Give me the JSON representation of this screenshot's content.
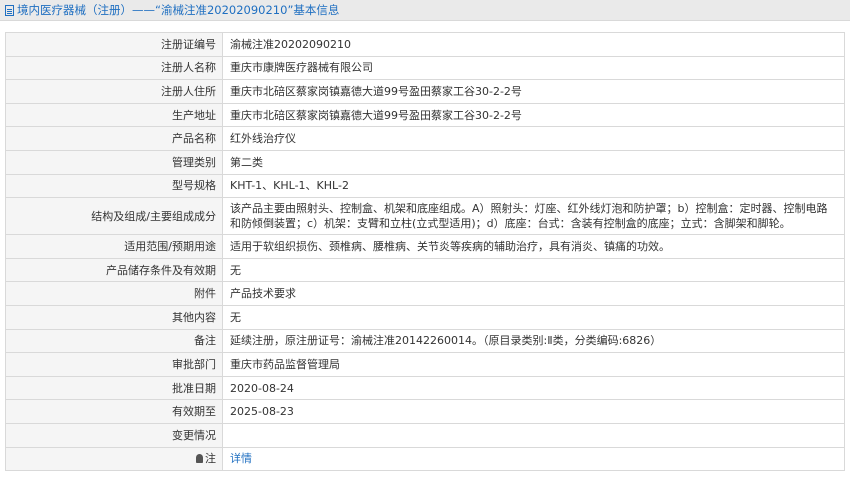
{
  "header": {
    "title_prefix": "境内医疗器械（注册）",
    "dash": " —— ",
    "title_reg": "“渝械注准20202090210”",
    "title_suffix": " 基本信息"
  },
  "rows": [
    {
      "label": "注册证编号",
      "value": "渝械注准20202090210"
    },
    {
      "label": "注册人名称",
      "value": "重庆市康牌医疗器械有限公司"
    },
    {
      "label": "注册人住所",
      "value": "重庆市北碚区蔡家岗镇嘉德大道99号盈田蔡家工谷30-2-2号"
    },
    {
      "label": "生产地址",
      "value": "重庆市北碚区蔡家岗镇嘉德大道99号盈田蔡家工谷30-2-2号"
    },
    {
      "label": "产品名称",
      "value": "红外线治疗仪"
    },
    {
      "label": "管理类别",
      "value": "第二类"
    },
    {
      "label": "型号规格",
      "value": "KHT-1、KHL-1、KHL-2"
    },
    {
      "label": "结构及组成/主要组成成分",
      "value": "该产品主要由照射头、控制盒、机架和底座组成。A）照射头：灯座、红外线灯泡和防护罩；b）控制盒：定时器、控制电路和防倾倒装置；c）机架：支臂和立柱(立式型适用)；d）底座：台式：含装有控制盒的底座；立式：含脚架和脚轮。"
    },
    {
      "label": "适用范围/预期用途",
      "value": "适用于软组织损伤、颈椎病、腰椎病、关节炎等疾病的辅助治疗，具有消炎、镇痛的功效。"
    },
    {
      "label": "产品储存条件及有效期",
      "value": "无"
    },
    {
      "label": "附件",
      "value": "产品技术要求"
    },
    {
      "label": "其他内容",
      "value": "无"
    },
    {
      "label": "备注",
      "value": "延续注册，原注册证号：渝械注准20142260014。（原目录类别:Ⅱ类，分类编码:6826）"
    },
    {
      "label": "审批部门",
      "value": "重庆市药品监督管理局"
    },
    {
      "label": "批准日期",
      "value": "2020-08-24"
    },
    {
      "label": "有效期至",
      "value": "2025-08-23"
    },
    {
      "label": "变更情况",
      "value": ""
    }
  ],
  "note_row": {
    "label": "注",
    "link": "详情"
  }
}
